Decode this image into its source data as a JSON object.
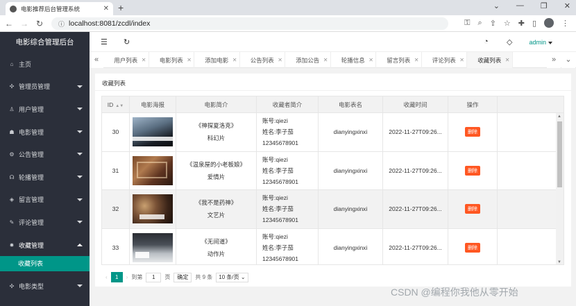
{
  "browser": {
    "tab_title": "电影推荐后台管理系统",
    "url": "localhost:8081/zcdl/index"
  },
  "sidebar": {
    "brand": "电影综合管理后台",
    "items": [
      {
        "label": "主页"
      },
      {
        "label": "管理员管理"
      },
      {
        "label": "用户管理"
      },
      {
        "label": "电影管理"
      },
      {
        "label": "公告管理"
      },
      {
        "label": "轮播管理"
      },
      {
        "label": "留言管理"
      },
      {
        "label": "评论管理"
      },
      {
        "label": "收藏管理"
      },
      {
        "label": "电影类型"
      }
    ],
    "sub_item": "收藏列表"
  },
  "topbar": {
    "user": "admin"
  },
  "tabs": [
    "用户列表",
    "电影列表",
    "添加电影",
    "公告列表",
    "添加公告",
    "轮播信息",
    "留言列表",
    "评论列表",
    "收藏列表"
  ],
  "page": {
    "title": "收藏列表"
  },
  "table": {
    "headers": [
      "ID",
      "电影海报",
      "电影简介",
      "收藏者简介",
      "电影表名",
      "收藏时间",
      "操作"
    ],
    "rows": [
      {
        "id": "30",
        "intro_name": "《神探夏洛克》",
        "intro_type": "科幻片",
        "user_account": "账号:qiezi",
        "user_name": "姓名:李子茄",
        "user_phone": "12345678901",
        "table": "dianyingxinxi",
        "time": "2022-11-27T09:26...",
        "action": "删除"
      },
      {
        "id": "31",
        "intro_name": "《温泉屋的小老板娘》",
        "intro_type": "爱情片",
        "user_account": "账号:qiezi",
        "user_name": "姓名:李子茄",
        "user_phone": "12345678901",
        "table": "dianyingxinxi",
        "time": "2022-11-27T09:26...",
        "action": "删除"
      },
      {
        "id": "32",
        "intro_name": "《我不是药神》",
        "intro_type": "文艺片",
        "user_account": "账号:qiezi",
        "user_name": "姓名:李子茄",
        "user_phone": "12345678901",
        "table": "dianyingxinxi",
        "time": "2022-11-27T09:26...",
        "action": "删除"
      },
      {
        "id": "33",
        "intro_name": "《无间道》",
        "intro_type": "动作片",
        "user_account": "账号:qiezi",
        "user_name": "姓名:李子茄",
        "user_phone": "12345678901",
        "table": "dianyingxinxi",
        "time": "2022-11-27T09:26...",
        "action": "删除"
      }
    ]
  },
  "pager": {
    "current": "1",
    "goto_label": "到第",
    "goto_value": "1",
    "page_unit": "页",
    "confirm": "确定",
    "total": "共 9 条",
    "page_size": "10 条/页"
  },
  "watermark": "CSDN @编程你我他从零开始"
}
